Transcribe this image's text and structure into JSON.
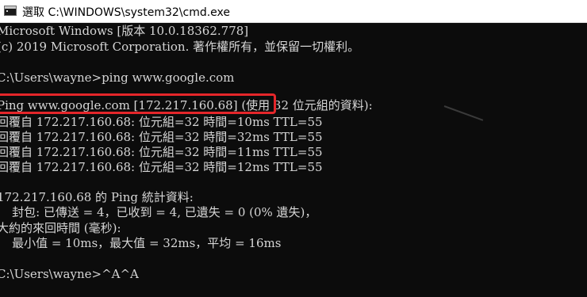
{
  "window": {
    "title": "選取 C:\\WINDOWS\\system32\\cmd.exe",
    "app_icon": "cmd-console-icon"
  },
  "console": {
    "lines": [
      "Microsoft Windows [版本 10.0.18362.778]",
      "(c) 2019 Microsoft Corporation. 著作權所有，並保留一切權利。",
      "",
      "C:\\Users\\wayne>ping www.google.com",
      "",
      "Ping www.google.com [172.217.160.68] (使用 32 位元組的資料):",
      "回覆自 172.217.160.68: 位元組=32 時間=10ms TTL=55",
      "回覆自 172.217.160.68: 位元組=32 時間=32ms TTL=55",
      "回覆自 172.217.160.68: 位元組=32 時間=11ms TTL=55",
      "回覆自 172.217.160.68: 位元組=32 時間=12ms TTL=55",
      "",
      "172.217.160.68 的 Ping 統計資料:",
      "    封包: 已傳送 = 4，已收到 = 4, 已遺失 = 0 (0% 遺失)，",
      "大約的來回時間 (毫秒):",
      "    最小值 = 10ms，最大值 = 32ms，平均 = 16ms",
      "",
      "C:\\Users\\wayne>^A^A"
    ]
  },
  "colors": {
    "console_background": "#0c0c0c",
    "console_text": "#d6d6d6",
    "highlight_border": "#e4262a",
    "titlebar_background": "#ffffff"
  }
}
